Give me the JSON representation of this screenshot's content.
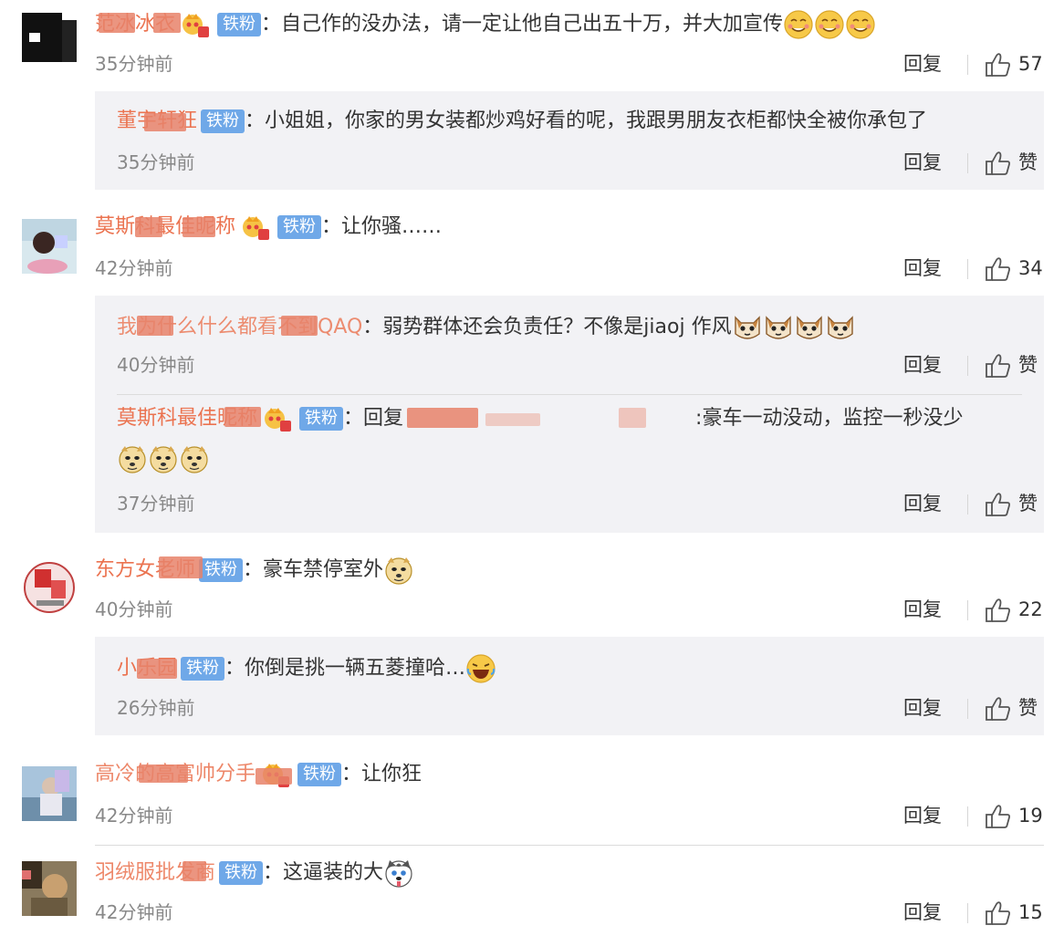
{
  "badge_label": "铁粉",
  "reply_label": "回复",
  "like_label": "赞",
  "comments": [
    {
      "user": "范冰冰衣",
      "text": "：自己作的没办法，请一定让他自己出五十万，并大加宣传",
      "time": "35分钟前",
      "likes": "57",
      "replies": [
        {
          "user": "董宇轩狂",
          "text": "：小姐姐，你家的男女装都炒鸡好看的呢，我跟男朋友衣柜都快全被你承包了",
          "time": "35分钟前"
        }
      ]
    },
    {
      "user": "莫斯科最佳昵称",
      "text": "：让你骚……",
      "time": "42分钟前",
      "likes": "34",
      "replies": [
        {
          "user": "我为什么什么都看不到QAQ",
          "text": "：弱势群体还会负责任？不像是jiaoj 作风",
          "time": "40分钟前"
        },
        {
          "user": "莫斯科最佳昵称",
          "text": "：回复",
          "text2": ":豪车一动没动，监控一秒没少",
          "time": "37分钟前"
        }
      ]
    },
    {
      "user": "东方女老师",
      "text": "：豪车禁停室外",
      "time": "40分钟前",
      "likes": "22",
      "replies": [
        {
          "user": "小乐园",
          "text": "：你倒是挑一辆五菱撞哈…",
          "time": "26分钟前"
        }
      ]
    },
    {
      "user": "高冷的高富帅分手",
      "text": "：让你狂",
      "time": "42分钟前",
      "likes": "19",
      "replies": []
    },
    {
      "user": "羽绒服批发商",
      "text": "：这逼装的大",
      "time": "42分钟前",
      "likes": "15",
      "replies": []
    }
  ],
  "colors": {
    "username": "#eb7350",
    "badge": "#6fa8e8",
    "reply_box": "#f2f2f5",
    "time": "#888888"
  }
}
